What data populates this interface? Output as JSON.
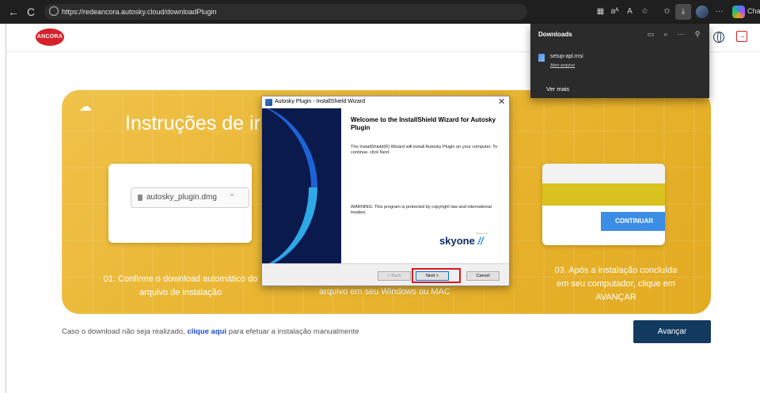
{
  "browser": {
    "url": "https://redeancora.autosky.cloud/downloadPlugin",
    "back_icon": "←",
    "reload_icon": "C",
    "chat_label": "Chat",
    "more_icon": "···"
  },
  "header": {
    "logo_text": "ANCORA"
  },
  "banner": {
    "title": "Instruções de ir",
    "step1": "01. Confirme o download automático do arquivo de instalação",
    "step2": "arquivo em seu Windows ou MAC",
    "step3": "03. Após a instalação concluída em seu computador, clique em AVANÇAR",
    "download_chip_file": "autosky_plugin.dmg",
    "continue_button": "CONTINUAR"
  },
  "downloads_panel": {
    "title": "Downloads",
    "file_name": "setup-apl.msi",
    "open_file": "Abrir arquivo",
    "see_more": "Ver mais"
  },
  "installer": {
    "window_title": "Autosky Plugin - InstallShield Wizard",
    "heading": "Welcome to the InstallShield Wizard for Autosky Plugin",
    "description": "The InstallShield(R) Wizard will install Autosky Plugin on your computer. To continue, click Next.",
    "warning": "WARNING: This program is protected by copyright law and international treaties.",
    "powered_by": "Powered by",
    "brand": "skyone",
    "back_button": "< Back",
    "next_button": "Next >",
    "cancel_button": "Cancel"
  },
  "footer": {
    "manual_prefix": "Caso o download não seja realizado, ",
    "manual_link": "clique aqui",
    "manual_suffix": " para efetuar a instalação manualmente",
    "next_button": "Avançar"
  },
  "colors": {
    "banner": "#e9b531",
    "primary_button": "#123a5e",
    "link": "#1e4ec8",
    "highlight": "#e01919",
    "logo": "#d6202a"
  }
}
